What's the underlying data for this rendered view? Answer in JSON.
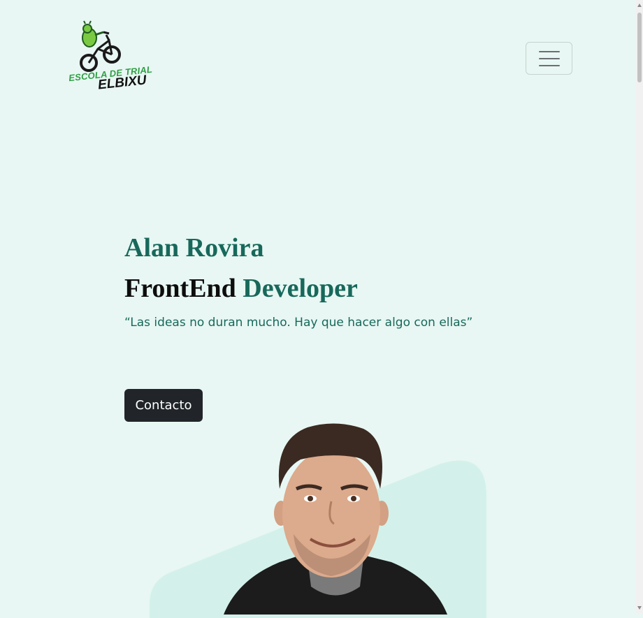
{
  "logo": {
    "line1": "ESCOLA DE TRIAL",
    "line2": "ELBIXU"
  },
  "navbar": {
    "toggle_icon": "hamburger-icon"
  },
  "hero": {
    "name": "Alan Rovira",
    "role_part1": "FrontEnd",
    "role_part2": "Developer",
    "quote": "“Las ideas no duran mucho. Hay que hacer algo con ellas”",
    "button_label": "Contacto"
  },
  "colors": {
    "background": "#e8f7f3",
    "accent": "#17685b",
    "button": "#212529",
    "shape": "#d3f1ea"
  }
}
